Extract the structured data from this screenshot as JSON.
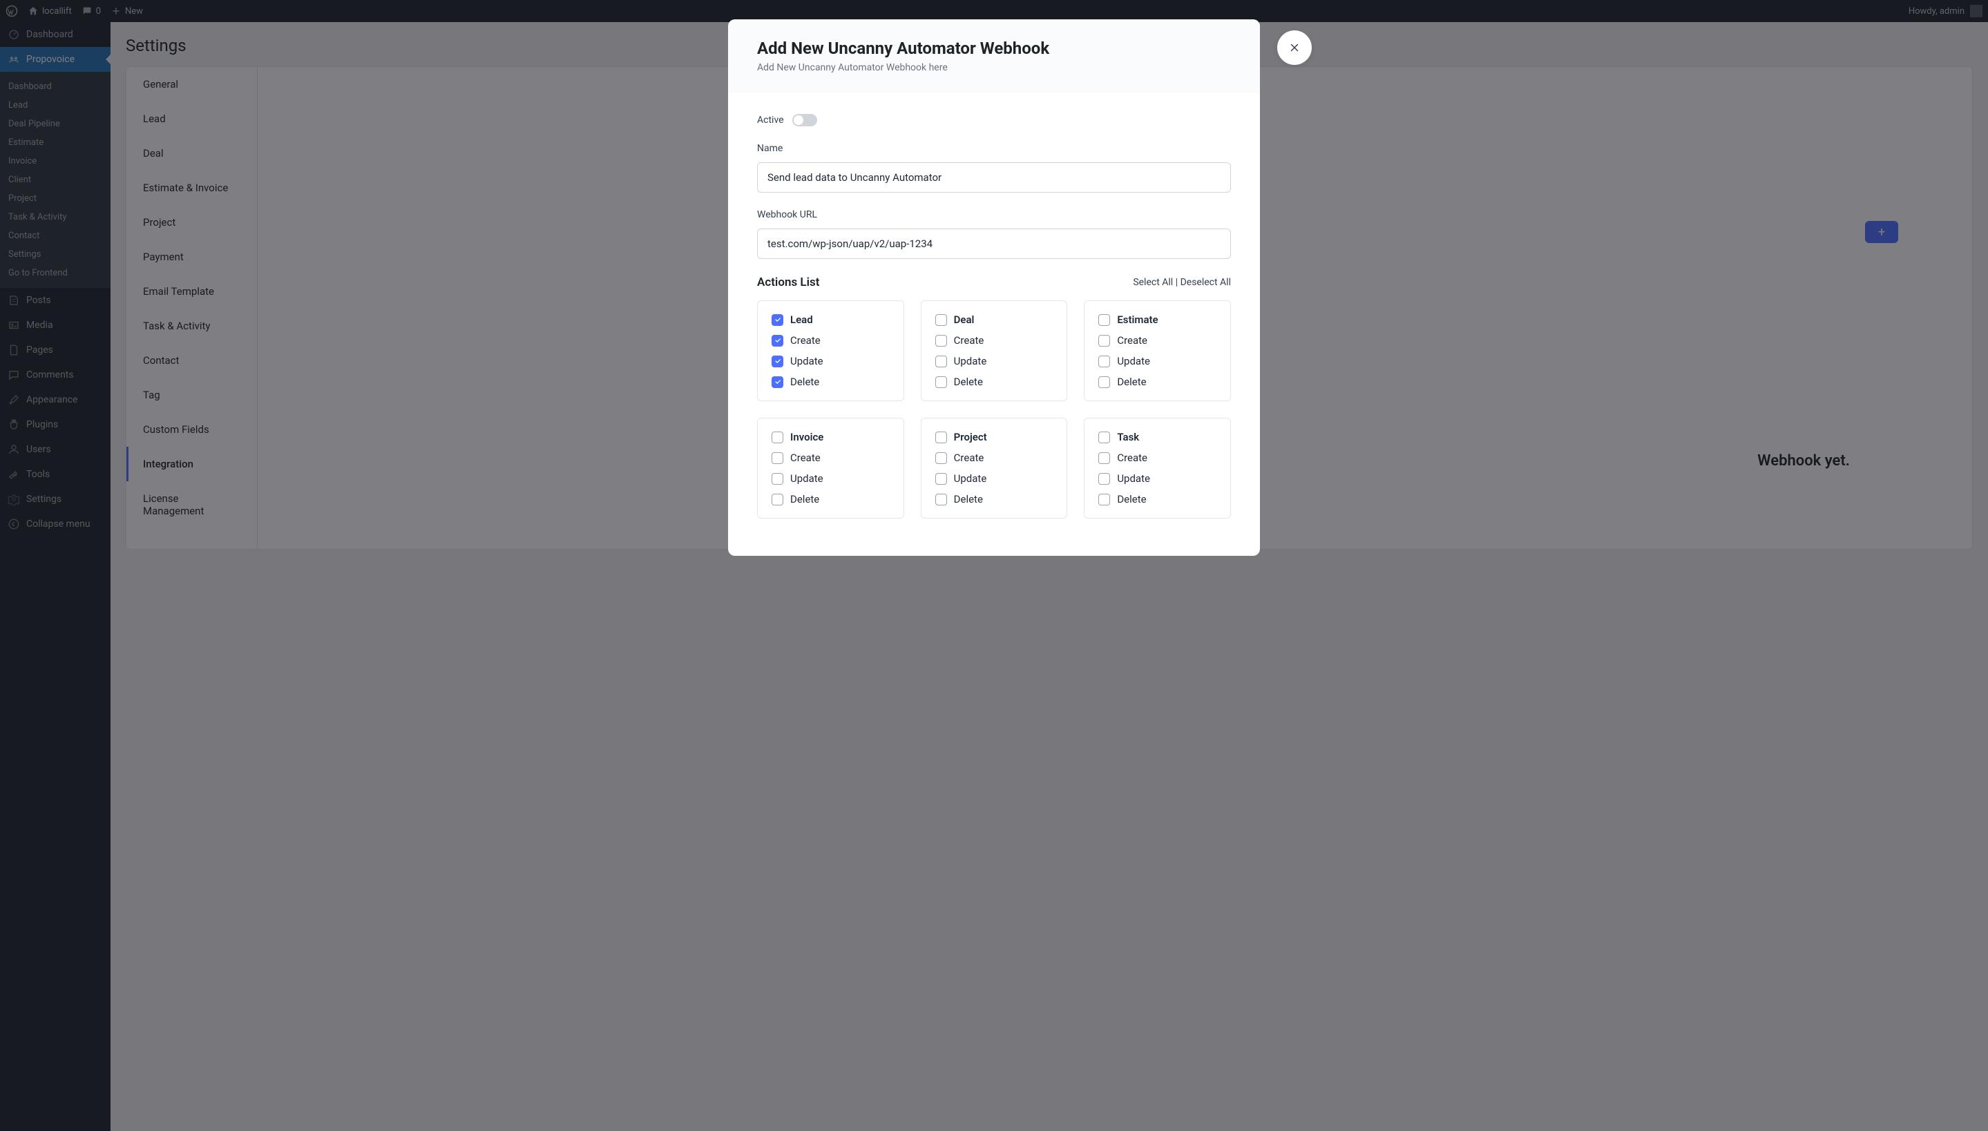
{
  "adminBar": {
    "siteName": "locallift",
    "commentCount": "0",
    "newLabel": "New",
    "howdy": "Howdy, admin"
  },
  "sidebar": {
    "dashboard": "Dashboard",
    "active": "Propovoice",
    "submenu": [
      "Dashboard",
      "Lead",
      "Deal Pipeline",
      "Estimate",
      "Invoice",
      "Client",
      "Project",
      "Task & Activity",
      "Contact",
      "Settings",
      "Go to Frontend"
    ],
    "menu": [
      "Posts",
      "Media",
      "Pages",
      "Comments",
      "Appearance",
      "Plugins",
      "Users",
      "Tools",
      "Settings",
      "Collapse menu"
    ]
  },
  "page": {
    "title": "Settings",
    "tabs": [
      "General",
      "Lead",
      "Deal",
      "Estimate & Invoice",
      "Project",
      "Payment",
      "Email Template",
      "Task & Activity",
      "Contact",
      "Tag",
      "Custom Fields",
      "Integration",
      "License Management"
    ],
    "noWebhook": "Webhook yet."
  },
  "modal": {
    "title": "Add New Uncanny Automator Webhook",
    "subtitle": "Add New Uncanny Automator Webhook here",
    "activeLabel": "Active",
    "nameLabel": "Name",
    "nameValue": "Send lead data to Uncanny Automator",
    "urlLabel": "Webhook URL",
    "urlValue": "test.com/wp-json/uap/v2/uap-1234",
    "actionsLabel": "Actions List",
    "selectAll": "Select All",
    "deselectAll": "Deselect All",
    "groups": [
      {
        "name": "Lead",
        "checked": true,
        "items": [
          {
            "label": "Create",
            "checked": true
          },
          {
            "label": "Update",
            "checked": true
          },
          {
            "label": "Delete",
            "checked": true
          }
        ]
      },
      {
        "name": "Deal",
        "checked": false,
        "items": [
          {
            "label": "Create",
            "checked": false
          },
          {
            "label": "Update",
            "checked": false
          },
          {
            "label": "Delete",
            "checked": false
          }
        ]
      },
      {
        "name": "Estimate",
        "checked": false,
        "items": [
          {
            "label": "Create",
            "checked": false
          },
          {
            "label": "Update",
            "checked": false
          },
          {
            "label": "Delete",
            "checked": false
          }
        ]
      },
      {
        "name": "Invoice",
        "checked": false,
        "items": [
          {
            "label": "Create",
            "checked": false
          },
          {
            "label": "Update",
            "checked": false
          },
          {
            "label": "Delete",
            "checked": false
          }
        ]
      },
      {
        "name": "Project",
        "checked": false,
        "items": [
          {
            "label": "Create",
            "checked": false
          },
          {
            "label": "Update",
            "checked": false
          },
          {
            "label": "Delete",
            "checked": false
          }
        ]
      },
      {
        "name": "Task",
        "checked": false,
        "items": [
          {
            "label": "Create",
            "checked": false
          },
          {
            "label": "Update",
            "checked": false
          },
          {
            "label": "Delete",
            "checked": false
          }
        ]
      }
    ]
  }
}
